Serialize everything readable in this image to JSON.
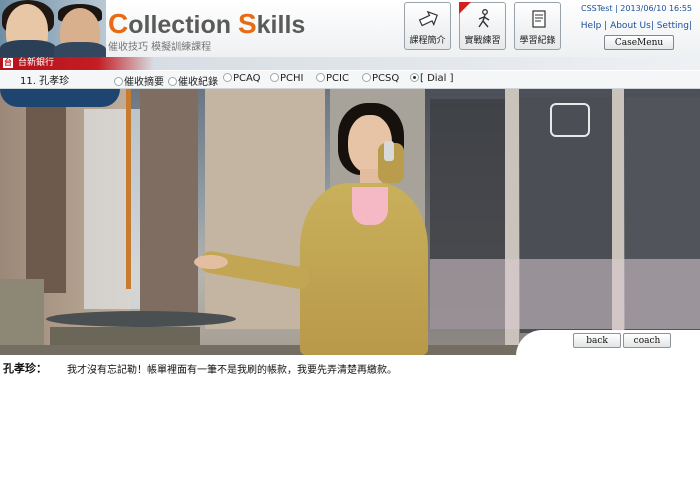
{
  "header": {
    "logo_title_c": "C",
    "logo_title_rest1": "ollection ",
    "logo_title_s": "S",
    "logo_title_rest2": "kills",
    "logo_subtitle": "催收技巧  模擬訓練課程",
    "buttons": [
      {
        "label": "課程簡介",
        "icon": "arrow-icon"
      },
      {
        "label": "實戰練習",
        "icon": "runner-icon"
      },
      {
        "label": "學習紀錄",
        "icon": "document-icon"
      }
    ],
    "user_info": "CSSTest | 2013/06/10 16:55",
    "links": {
      "help": "Help",
      "about": "About Us",
      "setting": "Setting"
    },
    "case_menu": "CaseMenu"
  },
  "bank": {
    "logo_text": "台",
    "name": "台新銀行"
  },
  "tabbar": {
    "case_title": "11. 孔孝珍",
    "tabs": [
      {
        "label": "催收摘要",
        "selected": false
      },
      {
        "label": "催收紀錄",
        "selected": false
      },
      {
        "label": "PCAQ",
        "selected": false
      },
      {
        "label": "PCHI",
        "selected": false
      },
      {
        "label": "PCIC",
        "selected": false
      },
      {
        "label": "PCSQ",
        "selected": false
      },
      {
        "label": "[ Dial ]",
        "selected": true
      }
    ]
  },
  "controls": {
    "back": "back",
    "coach": "coach"
  },
  "dialog": {
    "speaker": "孔孝珍：",
    "text": "我才沒有忘記勒！帳單裡面有一筆不是我刷的帳款，我要先弄清楚再繳款。"
  },
  "colors": {
    "brand_red": "#c41d24",
    "logo_orange": "#e86a12",
    "link_blue": "#1a4f9c"
  }
}
